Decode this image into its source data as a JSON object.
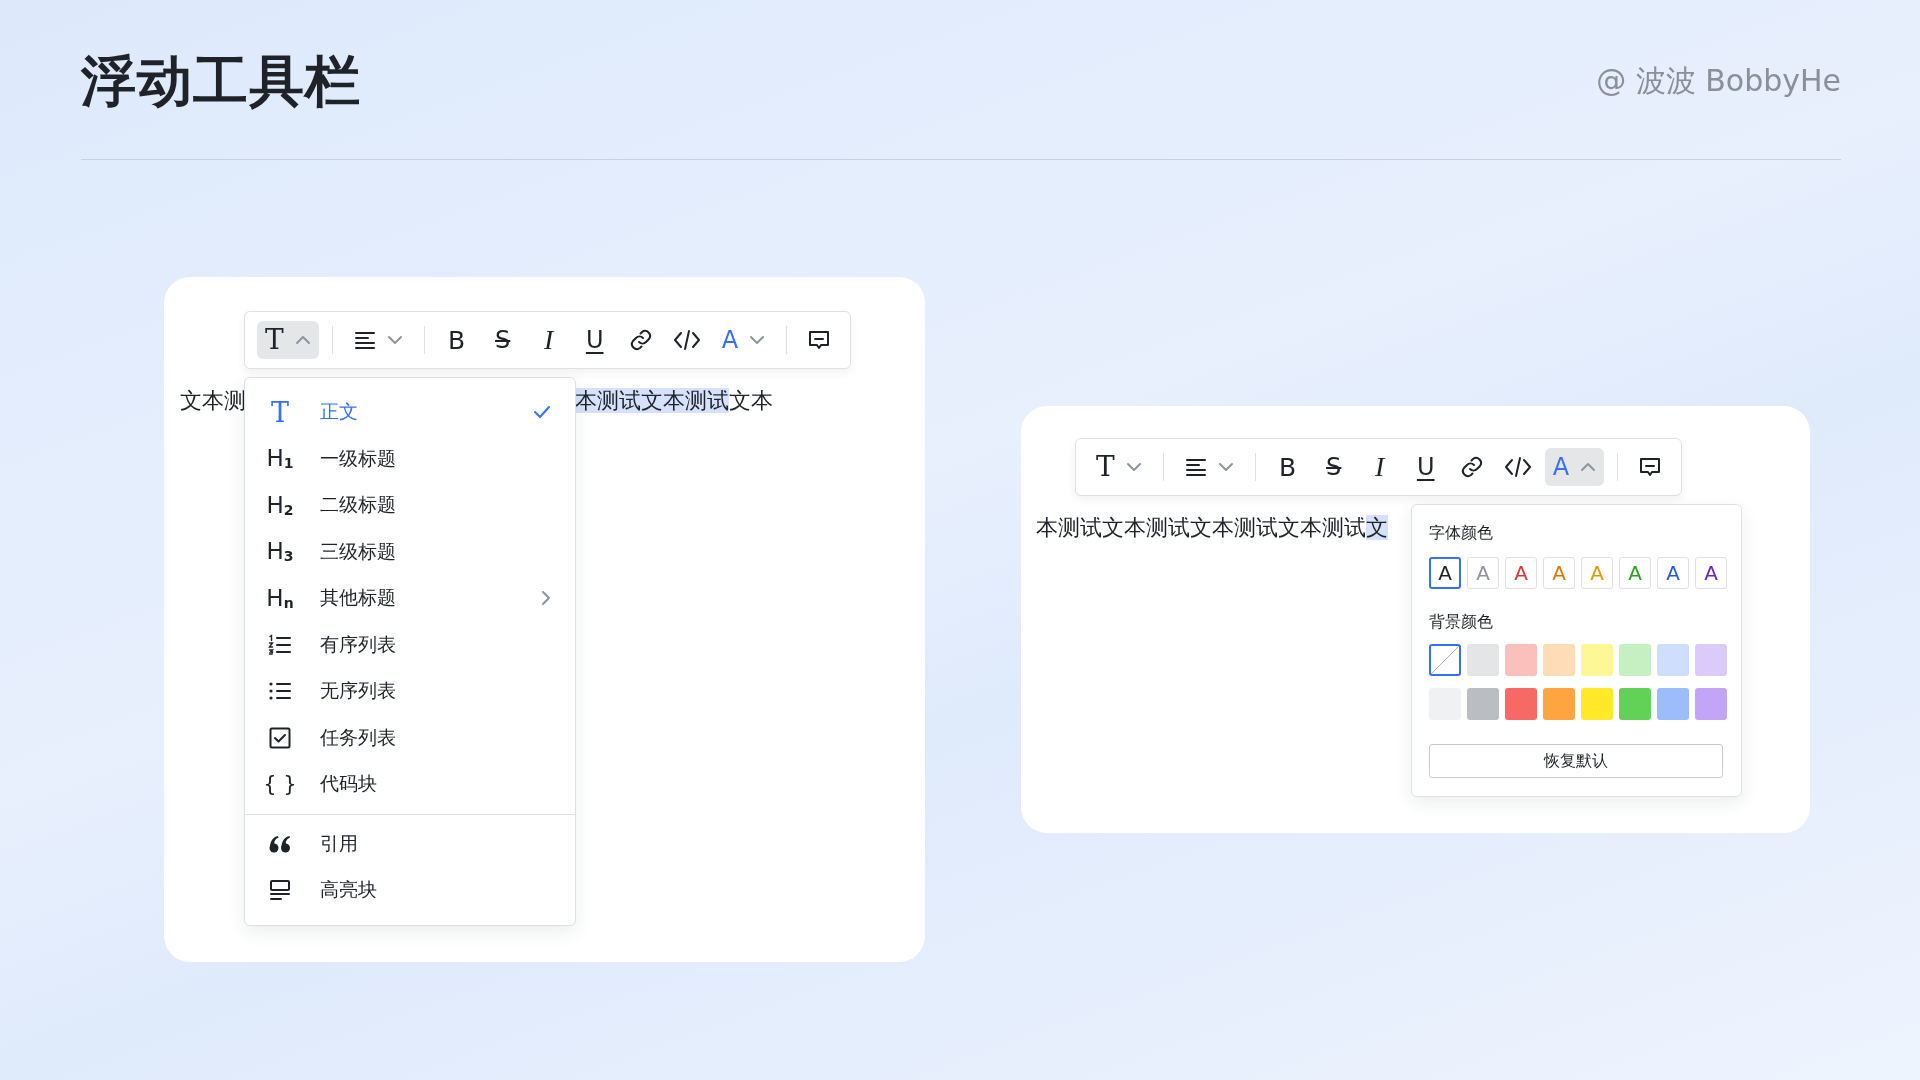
{
  "title": "浮动工具栏",
  "credit": "@ 波波 BobbyHe",
  "demos": [
    {
      "toolbar": [
        {
          "kind": "text-style",
          "glyph": "T",
          "open": true
        },
        {
          "kind": "divider"
        },
        {
          "kind": "align",
          "open": false
        },
        {
          "kind": "divider"
        },
        {
          "kind": "bold",
          "glyph": "B"
        },
        {
          "kind": "strike",
          "glyph": "S"
        },
        {
          "kind": "italic",
          "glyph": "I"
        },
        {
          "kind": "underline",
          "glyph": "U"
        },
        {
          "kind": "link"
        },
        {
          "kind": "code"
        },
        {
          "kind": "font-color",
          "glyph": "A",
          "open": false
        },
        {
          "kind": "divider"
        },
        {
          "kind": "comment"
        }
      ],
      "text_before": "文本测",
      "text_selected": "本测试文本测试",
      "text_after": "文本",
      "menu": {
        "groups": [
          [
            {
              "kind": "text",
              "glyph": "T",
              "label": "正文",
              "selected": true
            },
            {
              "kind": "heading",
              "glyph": "H$_{1}$",
              "label": "一级标题",
              "selected": false
            },
            {
              "kind": "heading",
              "glyph": "H$_{2}$",
              "label": "二级标题",
              "selected": false
            },
            {
              "kind": "heading",
              "glyph": "H$_{3}$",
              "label": "三级标题",
              "selected": false
            },
            {
              "kind": "heading",
              "glyph": "H$_{n}$",
              "label": "其他标题",
              "selected": false,
              "submenu": true
            },
            {
              "kind": "ordered-list",
              "label": "有序列表",
              "selected": false
            },
            {
              "kind": "bullet-list",
              "label": "无序列表",
              "selected": false
            },
            {
              "kind": "task-list",
              "label": "任务列表",
              "selected": false
            },
            {
              "kind": "code-block",
              "glyph": "{ }",
              "label": "代码块",
              "selected": false
            }
          ],
          [
            {
              "kind": "quote",
              "label": "引用",
              "selected": false
            },
            {
              "kind": "highlight",
              "label": "高亮块",
              "selected": false
            }
          ]
        ]
      }
    },
    {
      "toolbar": [
        {
          "kind": "text-style",
          "glyph": "T",
          "open": false
        },
        {
          "kind": "divider"
        },
        {
          "kind": "align",
          "open": false
        },
        {
          "kind": "divider"
        },
        {
          "kind": "bold",
          "glyph": "B"
        },
        {
          "kind": "strike",
          "glyph": "S"
        },
        {
          "kind": "italic",
          "glyph": "I"
        },
        {
          "kind": "underline",
          "glyph": "U"
        },
        {
          "kind": "link"
        },
        {
          "kind": "code"
        },
        {
          "kind": "font-color",
          "glyph": "A",
          "open": true
        },
        {
          "kind": "divider"
        },
        {
          "kind": "comment"
        }
      ],
      "text_before": "本测试文本测试文本测试文本测试",
      "text_selected": "文",
      "color_panel": {
        "font_label": "字体颜色",
        "font_colors": [
          {
            "glyph": "A",
            "color": "#1f2329",
            "selected": true
          },
          {
            "glyph": "A",
            "color": "#8f959e",
            "selected": false
          },
          {
            "glyph": "A",
            "color": "#d83931",
            "selected": false
          },
          {
            "glyph": "A",
            "color": "#de7802",
            "selected": false
          },
          {
            "glyph": "A",
            "color": "#dc9b04",
            "selected": false
          },
          {
            "glyph": "A",
            "color": "#2ea121",
            "selected": false
          },
          {
            "glyph": "A",
            "color": "#245bdb",
            "selected": false
          },
          {
            "glyph": "A",
            "color": "#6425d0",
            "selected": false
          }
        ],
        "background_label": "背景颜色",
        "background_colors": [
          {
            "kind": "none",
            "selected": true
          },
          {
            "color": "#e4e5e7",
            "selected": false
          },
          {
            "color": "#fbbfbc",
            "selected": false
          },
          {
            "color": "#fedcb5",
            "selected": false
          },
          {
            "color": "#fef796",
            "selected": false
          },
          {
            "color": "#c6f0c1",
            "selected": false
          },
          {
            "color": "#cfdefc",
            "selected": false
          },
          {
            "color": "#dccbfa",
            "selected": false
          },
          {
            "color": "#f0f1f3",
            "selected": false
          },
          {
            "color": "#babdc1",
            "selected": false
          },
          {
            "color": "#f76964",
            "selected": false
          },
          {
            "color": "#ffa53d",
            "selected": false
          },
          {
            "color": "#ffe928",
            "selected": false
          },
          {
            "color": "#62d256",
            "selected": false
          },
          {
            "color": "#9cbcfb",
            "selected": false
          },
          {
            "color": "#c3a5f7",
            "selected": false
          }
        ],
        "reset_button": "恢复默认"
      }
    }
  ]
}
